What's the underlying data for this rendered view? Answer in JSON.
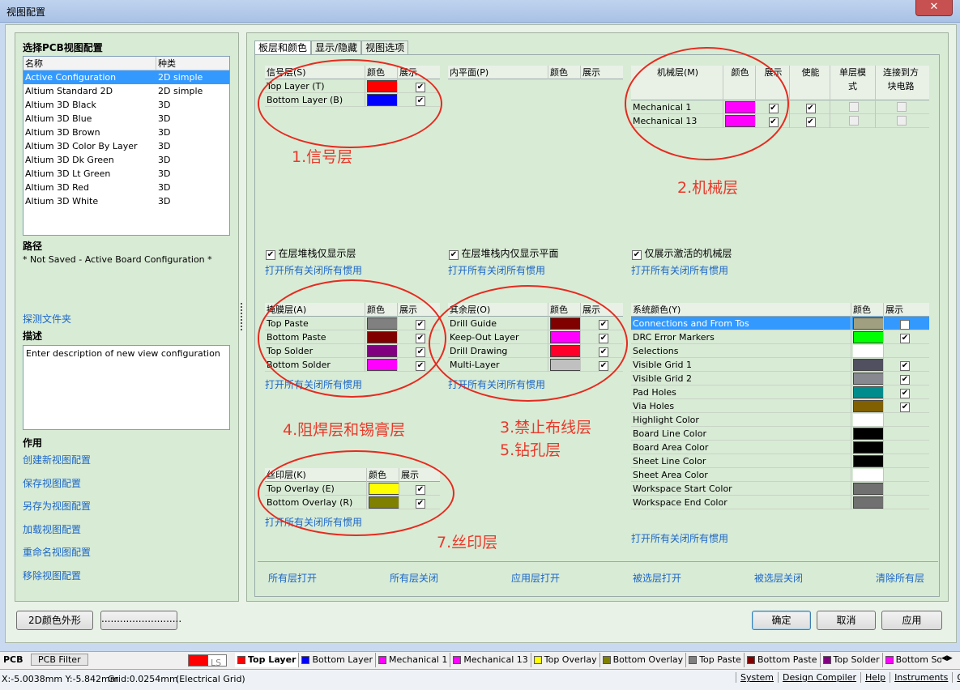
{
  "window": {
    "title": "视图配置",
    "close": "✕"
  },
  "left": {
    "title": "选择PCB视图配置",
    "col_name": "名称",
    "col_kind": "种类",
    "configs": [
      {
        "name": "Active Configuration",
        "kind": "2D simple"
      },
      {
        "name": "Altium Standard 2D",
        "kind": "2D simple"
      },
      {
        "name": "Altium 3D Black",
        "kind": "3D"
      },
      {
        "name": "Altium 3D Blue",
        "kind": "3D"
      },
      {
        "name": "Altium 3D Brown",
        "kind": "3D"
      },
      {
        "name": "Altium 3D Color By Layer",
        "kind": "3D"
      },
      {
        "name": "Altium 3D Dk Green",
        "kind": "3D"
      },
      {
        "name": "Altium 3D Lt Green",
        "kind": "3D"
      },
      {
        "name": "Altium 3D Red",
        "kind": "3D"
      },
      {
        "name": "Altium 3D White",
        "kind": "3D"
      }
    ],
    "path_label": "路径",
    "path_value": "* Not Saved - Active Board Configuration *",
    "explore": "探测文件夹",
    "desc_label": "描述",
    "desc_value": "Enter description of new view configuration",
    "action_label": "作用",
    "actions": [
      "创建新视图配置",
      "保存视图配置",
      "另存为视图配置",
      "加载视图配置",
      "重命名视图配置",
      "移除视图配置"
    ]
  },
  "tabs": [
    "板层和颜色",
    "显示/隐藏",
    "视图选项"
  ],
  "colhdr": {
    "color": "颜色",
    "show": "展示",
    "enable": "使能",
    "single": "单层模式",
    "connect": "连接到方块电路"
  },
  "signal": {
    "title": "信号层(S)",
    "rows": [
      {
        "name": "Top Layer (T)",
        "color": "#ff0000"
      },
      {
        "name": "Bottom Layer (B)",
        "color": "#0000ff"
      }
    ],
    "chk": "在层堆栈仅显示层",
    "link": "打开所有关闭所有惯用"
  },
  "plane": {
    "title": "内平面(P)",
    "chk": "在层堆栈内仅显示平面",
    "link": "打开所有关闭所有惯用"
  },
  "mech": {
    "title": "机械层(M)",
    "rows": [
      {
        "name": "Mechanical 1",
        "color": "#ff00ff"
      },
      {
        "name": "Mechanical 13",
        "color": "#ff00ff"
      }
    ],
    "chk": "仅展示激活的机械层",
    "link": "打开所有关闭所有惯用"
  },
  "mask": {
    "title": "掩膜层(A)",
    "rows": [
      {
        "name": "Top Paste",
        "color": "#808080"
      },
      {
        "name": "Bottom Paste",
        "color": "#800000"
      },
      {
        "name": "Top Solder",
        "color": "#800080"
      },
      {
        "name": "Bottom Solder",
        "color": "#ff00ff"
      }
    ],
    "link": "打开所有关闭所有惯用"
  },
  "other": {
    "title": "其余层(O)",
    "rows": [
      {
        "name": "Drill Guide",
        "color": "#800000"
      },
      {
        "name": "Keep-Out Layer",
        "color": "#ff00ff"
      },
      {
        "name": "Drill Drawing",
        "color": "#ff002a"
      },
      {
        "name": "Multi-Layer",
        "color": "#c0c0c0"
      }
    ],
    "link": "打开所有关闭所有惯用"
  },
  "silk": {
    "title": "丝印层(K)",
    "rows": [
      {
        "name": "Top Overlay (E)",
        "color": "#ffff00"
      },
      {
        "name": "Bottom Overlay (R)",
        "color": "#808000"
      }
    ],
    "link": "打开所有关闭所有惯用"
  },
  "system": {
    "title": "系统颜色(Y)",
    "rows": [
      {
        "name": "Connections and From Tos",
        "color": "#a0a080",
        "show": true
      },
      {
        "name": "DRC Error Markers",
        "color": "#00ff00",
        "show": true
      },
      {
        "name": "Selections",
        "color": "#ffffff",
        "show": false
      },
      {
        "name": "Visible Grid 1",
        "color": "#505060",
        "show": true
      },
      {
        "name": "Visible Grid 2",
        "color": "#888890",
        "show": true
      },
      {
        "name": "Pad Holes",
        "color": "#008c8c",
        "show": true
      },
      {
        "name": "Via Holes",
        "color": "#806000",
        "show": true
      },
      {
        "name": "Highlight Color",
        "color": "#ffffff",
        "show": false
      },
      {
        "name": "Board Line Color",
        "color": "#000000",
        "show": false
      },
      {
        "name": "Board Area Color",
        "color": "#000000",
        "show": false
      },
      {
        "name": "Sheet Line Color",
        "color": "#000000",
        "show": false
      },
      {
        "name": "Sheet Area Color",
        "color": "#ffffff",
        "show": false
      },
      {
        "name": "Workspace Start Color",
        "color": "#707070",
        "show": false
      },
      {
        "name": "Workspace End Color",
        "color": "#707070",
        "show": false
      }
    ],
    "link": "打开所有关闭所有惯用"
  },
  "annotations": [
    "1.信号层",
    "2.机械层",
    "4.阻焊层和锡膏层",
    "3.禁止布线层",
    "5.钻孔层",
    "7.丝印层"
  ],
  "bottom_links": [
    "所有层打开",
    "所有层关闭",
    "应用层打开",
    "被选层打开",
    "被选层关闭",
    "清除所有层"
  ],
  "buttons": {
    "color2d": "2D颜色外形",
    "ellipsis": "..........................",
    "ok": "确定",
    "cancel": "取消",
    "apply": "应用"
  },
  "layer_tabs": {
    "pcb": "PCB",
    "filter": "PCB Filter",
    "ls": "LS",
    "items": [
      {
        "name": "Top Layer",
        "color": "#ff0000"
      },
      {
        "name": "Bottom Layer",
        "color": "#0000ff"
      },
      {
        "name": "Mechanical 1",
        "color": "#ff00ff"
      },
      {
        "name": "Mechanical 13",
        "color": "#ff00ff"
      },
      {
        "name": "Top Overlay",
        "color": "#ffff00"
      },
      {
        "name": "Bottom Overlay",
        "color": "#808000"
      },
      {
        "name": "Top Paste",
        "color": "#808080"
      },
      {
        "name": "Bottom Paste",
        "color": "#800000"
      },
      {
        "name": "Top Solder",
        "color": "#800080"
      },
      {
        "name": "Bottom Solder",
        "color": "#ff00ff"
      }
    ]
  },
  "status": {
    "coords": "X:-5.0038mm Y:-5.842mm",
    "grid": "Grid:0.0254mm",
    "mode": "(Electrical Grid)",
    "tabs": [
      "System",
      "Design Compiler",
      "Help",
      "Instruments",
      "Oper"
    ]
  }
}
